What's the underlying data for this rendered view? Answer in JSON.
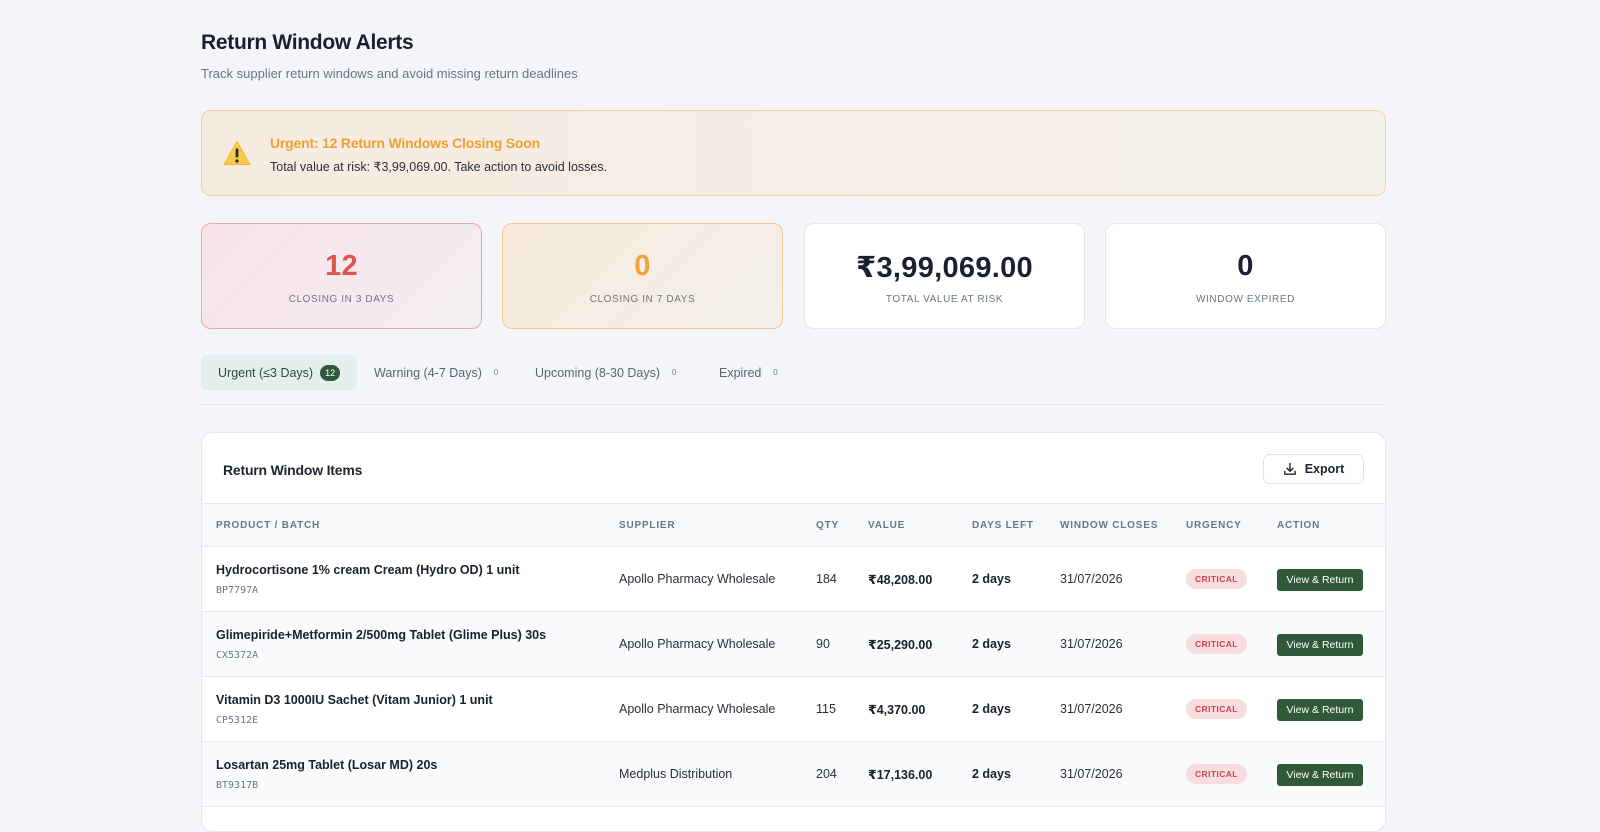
{
  "header": {
    "title": "Return Window Alerts",
    "subtitle": "Track supplier return windows and avoid missing return deadlines"
  },
  "alert": {
    "icon": "warning-icon",
    "title": "Urgent: 12 Return Windows Closing Soon",
    "text": "Total value at risk: ₹3,99,069.00. Take action to avoid losses."
  },
  "stats": [
    {
      "value": "12",
      "label": "CLOSING IN 3 DAYS"
    },
    {
      "value": "0",
      "label": "CLOSING IN 7 DAYS"
    },
    {
      "value": "₹3,99,069.00",
      "label": "TOTAL VALUE AT RISK"
    },
    {
      "value": "0",
      "label": "WINDOW EXPIRED"
    }
  ],
  "tabs": [
    {
      "label": "Urgent (≤3 Days)",
      "count": "12"
    },
    {
      "label": "Warning (4-7 Days)",
      "count": "0"
    },
    {
      "label": "Upcoming (8-30 Days)",
      "count": "0"
    },
    {
      "label": "Expired",
      "count": "0"
    }
  ],
  "table": {
    "title": "Return Window Items",
    "export_label": "Export",
    "columns": [
      "PRODUCT / BATCH",
      "SUPPLIER",
      "QTY",
      "VALUE",
      "DAYS LEFT",
      "WINDOW CLOSES",
      "URGENCY",
      "ACTION"
    ],
    "rows": [
      {
        "product": "Hydrocortisone 1% cream Cream (Hydro OD) 1 unit",
        "batch": "BP7797A",
        "supplier": "Apollo Pharmacy Wholesale",
        "qty": "184",
        "value": "₹48,208.00",
        "days_left": "2 days",
        "closes": "31/07/2026",
        "urgency": "CRITICAL",
        "action": "View & Return"
      },
      {
        "product": "Glimepiride+Metformin 2/500mg Tablet (Glime Plus) 30s",
        "batch": "CX5372A",
        "supplier": "Apollo Pharmacy Wholesale",
        "qty": "90",
        "value": "₹25,290.00",
        "days_left": "2 days",
        "closes": "31/07/2026",
        "urgency": "CRITICAL",
        "action": "View & Return"
      },
      {
        "product": "Vitamin D3 1000IU Sachet (Vitam Junior) 1 unit",
        "batch": "CP5312E",
        "supplier": "Apollo Pharmacy Wholesale",
        "qty": "115",
        "value": "₹4,370.00",
        "days_left": "2 days",
        "closes": "31/07/2026",
        "urgency": "CRITICAL",
        "action": "View & Return"
      },
      {
        "product": "Losartan 25mg Tablet (Losar MD) 20s",
        "batch": "BT9317B",
        "supplier": "Medplus Distribution",
        "qty": "204",
        "value": "₹17,136.00",
        "days_left": "2 days",
        "closes": "31/07/2026",
        "urgency": "CRITICAL",
        "action": "View & Return"
      }
    ]
  },
  "colors": {
    "accent_green": "#30593a",
    "critical_red": "#e0534f",
    "warning_orange": "#f2a23a"
  }
}
